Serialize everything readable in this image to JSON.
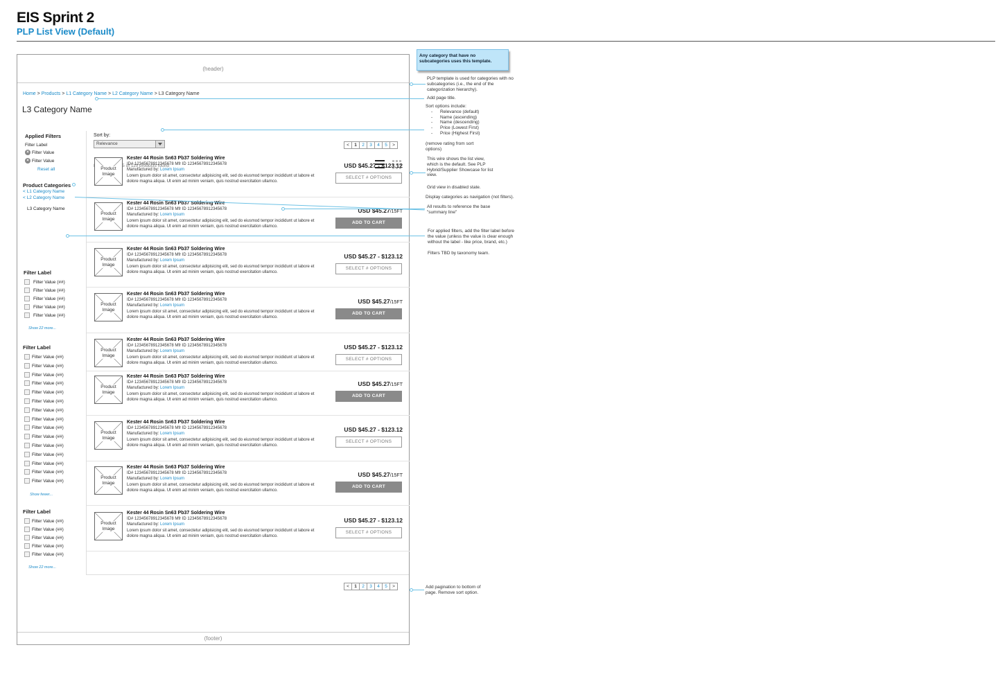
{
  "doc": {
    "title": "EIS Sprint 2",
    "subtitle": "PLP List View (Default)",
    "header_label": "(header)",
    "footer_label": "(footer)"
  },
  "breadcrumb": {
    "items": [
      "Home",
      "Products",
      "L1 Category Name",
      "L2 Category Name",
      "L3 Category Name"
    ],
    "separator": ">"
  },
  "page_title": "L3 Category Name",
  "sidebar": {
    "applied_filters": {
      "heading": "Applied Filters",
      "label": "Filter Label",
      "values": [
        "Filter Value",
        "Filter Value"
      ],
      "reset": "Reset all"
    },
    "categories": {
      "heading": "Product Categories",
      "links": [
        "< L1 Category Name",
        "< L2 Category Name"
      ],
      "current": "L3 Category Name"
    },
    "groups": [
      {
        "label": "Filter Label",
        "options": [
          "Filter Value (##)",
          "Filter Value (##)",
          "Filter Value (##)",
          "Filter Value (##)",
          "Filter Value (##)"
        ],
        "more": "Show 22 more..."
      },
      {
        "label": "Filter Label",
        "options": [
          "Filter Value (##)",
          "Filter Value (##)",
          "Filter Value (##)",
          "Filter Value (##)",
          "Filter Value (##)",
          "Filter Value (##)",
          "Filter Value (##)",
          "Filter Value (##)",
          "Filter Value (##)",
          "Filter Value (##)",
          "Filter Value (##)",
          "Filter Value (##)",
          "Filter Value (##)",
          "Filter Value (##)",
          "Filter Value (##)"
        ],
        "more": "Show fewer..."
      },
      {
        "label": "Filter Label",
        "options": [
          "Filter Value (##)",
          "Filter Value (##)",
          "Filter Value (##)",
          "Filter Value (##)",
          "Filter Value (##)"
        ],
        "more": "Show 22 more..."
      }
    ]
  },
  "sort": {
    "label": "Sort by:",
    "value": "Relevance"
  },
  "pagination": {
    "prev": "<",
    "next": ">",
    "pages": [
      "1",
      "2",
      "3",
      "4",
      "5"
    ],
    "active": "1"
  },
  "results_text": "Displaying 1-25 of 110 products found",
  "product_template": {
    "image_label": "Product Image",
    "name": "Kester 44 Rosin Sn63 Pb37 Soldering Wire",
    "ids": "ID# 1234567891234567​8  Mfr ID 12345678912345678",
    "mfr_label": "Manufactured by:",
    "mfr_value": "Lorem Ipsum",
    "desc": "Lorem ipsum dolor sit amet, consectetur adipisicing elit, sed do eiusmod tempor incididunt ut labore et dolore magna aliqua. Ut enim ad minim veniam, quis nostrud exercitation ullamco."
  },
  "products": [
    {
      "price": "USD $45.27 - $123.12",
      "unit": "",
      "button": "SELECT # OPTIONS",
      "type": "select"
    },
    {
      "price": "USD $45.27",
      "unit": "/15FT",
      "button": "ADD TO CART",
      "type": "cart"
    },
    {
      "price": "USD $45.27 - $123.12",
      "unit": "",
      "button": "SELECT # OPTIONS",
      "type": "select"
    },
    {
      "price": "USD $45.27",
      "unit": "/15FT",
      "button": "ADD TO CART",
      "type": "cart"
    },
    {
      "price": "USD $45.27 - $123.12",
      "unit": "",
      "button": "SELECT # OPTIONS",
      "type": "select"
    },
    {
      "price": "USD $45.27",
      "unit": "/15FT",
      "button": "ADD TO CART",
      "type": "cart"
    },
    {
      "price": "USD $45.27 - $123.12",
      "unit": "",
      "button": "SELECT # OPTIONS",
      "type": "select"
    },
    {
      "price": "USD $45.27",
      "unit": "/15FT",
      "button": "ADD TO CART",
      "type": "cart"
    },
    {
      "price": "USD $45.27 - $123.12",
      "unit": "",
      "button": "SELECT # OPTIONS",
      "type": "select"
    }
  ],
  "annotations": {
    "callout": "Any category that have no subcategories uses this template.",
    "note1": "PLP template is used for categories with no subcategories (i.e., the end of the categorization hierarchy).",
    "note2": "Add page title.",
    "note3_head": "Sort options include:",
    "note3_items": [
      "Relevance (default)",
      "Name (ascending)",
      "Name (descending)",
      "Price (Lowest First)",
      "Price (Highest First)"
    ],
    "note4": "(remove rating from sort options)",
    "note5": "This wire shows the list view, which is the default. See PLP Hybrid/Supplier Showcase for list view.",
    "note6": "Grid view in disabled state.",
    "note7": "Display categories as navigation (not filters).",
    "note8": "All results to reference the base \"summary line\"",
    "note9": "For applied filters, add the filter label before the value (unless the value is clear enough without the label - like price, brand, etc.)",
    "note10": "Filters TBD by taxonomy team.",
    "note11": "Add pagination to bottom of page. Remove sort option."
  },
  "colors": {
    "link": "#1a8ac8",
    "connector": "#6cc1e5",
    "callout_bg": "#bfe5f9",
    "cart_button": "#8a8a8a"
  }
}
